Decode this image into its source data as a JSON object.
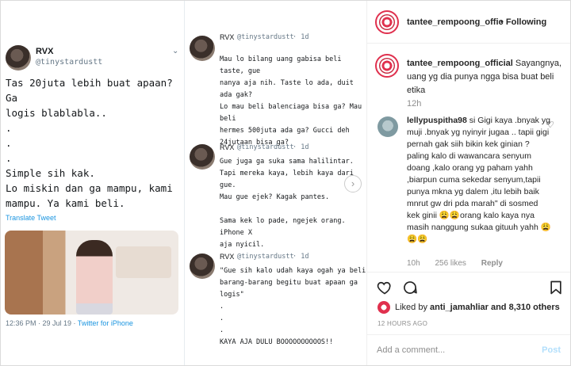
{
  "tweet_main": {
    "name": "RVX",
    "handle": "@tinystardustt",
    "text": "Tas 20juta lebih buat apaan? Ga\nlogis blablabla..\n.\n.\n.\nSimple sih kak.\nLo miskin dan ga mampu, kami\nmampu. Ya kami beli.",
    "translate": "Translate Tweet",
    "time": "12:36 PM · 29 Jul 19 · ",
    "via": "Twitter for iPhone"
  },
  "replies": [
    {
      "name": "RVX",
      "handle": "@tinystardustt",
      "age": "· 1d",
      "text": "Mau lo bilang uang gabisa beli taste, gue\nnanya aja nih. Taste lo ada, duit ada gak?\nLo mau beli balenciaga bisa ga? Mau beli\nhermes 500juta ada ga? Gucci deh\n24jutaan bisa ga?"
    },
    {
      "name": "RVX",
      "handle": "@tinystardustt",
      "age": "· 1d",
      "text": "Gue juga ga suka sama halilintar.\nTapi mereka kaya, lebih kaya dari gue.\nMau gue ejek? Kagak pantes.\n\nSama kek lo pade, ngejek orang. iPhone X\naja nyicil."
    },
    {
      "name": "RVX",
      "handle": "@tinystardustt",
      "age": "· 1d",
      "text": "\"Gue sih kalo udah kaya ogah ya beli\nbarang-barang begitu buat apaan ga logis\"\n.\n.\n.\nKAYA AJA DULU BOOOOOOOOOOS!!"
    }
  ],
  "ig": {
    "username": "tantee_rempoong_offic",
    "follow": "• Following",
    "more": "•••",
    "caption_user": "tantee_rempoong_official",
    "caption_text": "Sayangnya, uang yg dia punya ngga bisa buat beli etika",
    "caption_time": "12h",
    "comment_user": "lellypuspitha98",
    "comment_text": "si Gigi kaya .bnyak yg muji .bnyak yg nyinyir jugaa .. tapii gigi pernah gak siih bikin kek ginian ? paling kalo di wawancara senyum doang ,kalo orang yg paham yahh ,biarpun cuma sekedar senyum,tapii punya mkna yg dalem ,itu lebih baik mnrut gw dri pda marah\" di sosmed kek ginii 😩😩orang kalo kaya nya masih nanggung sukaa gituuh yahh 😩😩😩",
    "comment_time": "10h",
    "comment_likes": "256 likes",
    "comment_reply": "Reply",
    "liked_by_prefix": "Liked by ",
    "liked_by_user": "anti_jamahliar",
    "liked_by_suffix": " and 8,310 others",
    "post_time": "12 HOURS AGO",
    "add_comment_placeholder": "Add a comment...",
    "post_button": "Post"
  }
}
